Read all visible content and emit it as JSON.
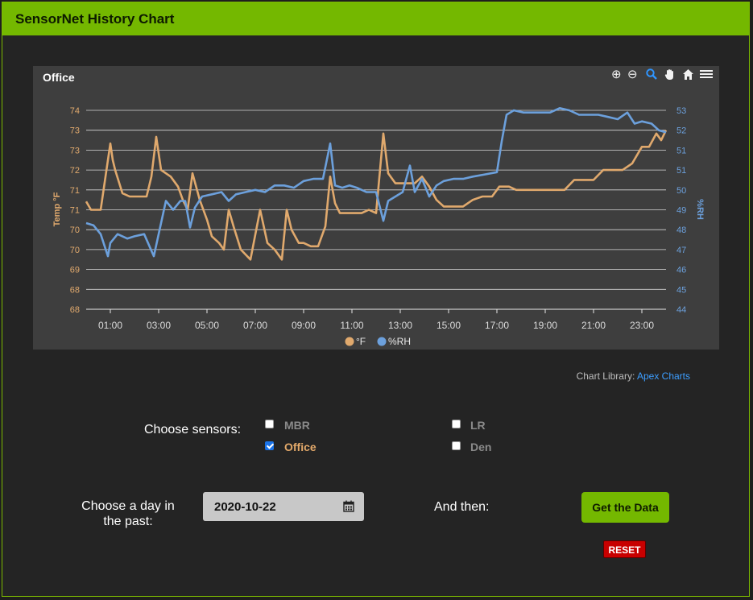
{
  "header": {
    "title": "SensorNet History Chart"
  },
  "chart_toolbar": {
    "icons": [
      "zoom-in-icon",
      "zoom-out-icon",
      "zoom-select-icon",
      "pan-hand-icon",
      "home-reset-icon",
      "menu-icon"
    ]
  },
  "chart_data": {
    "type": "line",
    "title": "Office",
    "x_unit": "hour of day",
    "x_ticks": [
      "01:00",
      "03:00",
      "05:00",
      "07:00",
      "09:00",
      "11:00",
      "13:00",
      "15:00",
      "17:00",
      "19:00",
      "21:00",
      "23:00"
    ],
    "xlim": [
      0,
      24
    ],
    "y_left": {
      "label": "Temp °F",
      "ylim": [
        68,
        74
      ],
      "ticks": [
        "74",
        "73",
        "73",
        "72",
        "71",
        "71",
        "70",
        "70",
        "69",
        "68",
        "68"
      ]
    },
    "y_right": {
      "label": "%RH",
      "ylim": [
        44,
        53
      ],
      "ticks": [
        "53",
        "52",
        "51",
        "51",
        "50",
        "49",
        "48",
        "47",
        "46",
        "45",
        "44"
      ]
    },
    "grid": true,
    "legend_position": "bottom-center",
    "series": [
      {
        "name": "°F",
        "axis": "left",
        "color": "#e0a96d",
        "points": [
          [
            0,
            71.25
          ],
          [
            0.2,
            71
          ],
          [
            0.6,
            71
          ],
          [
            0.8,
            72
          ],
          [
            1.0,
            73.0
          ],
          [
            1.1,
            72.5
          ],
          [
            1.2,
            72.2
          ],
          [
            1.5,
            71.5
          ],
          [
            1.8,
            71.4
          ],
          [
            2.2,
            71.4
          ],
          [
            2.5,
            71.4
          ],
          [
            2.7,
            72.0
          ],
          [
            2.9,
            73.2
          ],
          [
            3.1,
            72.2
          ],
          [
            3.5,
            72.0
          ],
          [
            3.8,
            71.7
          ],
          [
            4.0,
            71.3
          ],
          [
            4.2,
            71.0
          ],
          [
            4.4,
            72.1
          ],
          [
            4.7,
            71.3
          ],
          [
            5.0,
            70.7
          ],
          [
            5.2,
            70.2
          ],
          [
            5.5,
            70.0
          ],
          [
            5.7,
            69.8
          ],
          [
            5.9,
            71.0
          ],
          [
            6.1,
            70.5
          ],
          [
            6.4,
            69.8
          ],
          [
            6.8,
            69.5
          ],
          [
            7.2,
            71.0
          ],
          [
            7.5,
            70.0
          ],
          [
            7.8,
            69.8
          ],
          [
            8.1,
            69.5
          ],
          [
            8.3,
            71.0
          ],
          [
            8.5,
            70.4
          ],
          [
            8.8,
            70.0
          ],
          [
            9.0,
            70.0
          ],
          [
            9.3,
            69.9
          ],
          [
            9.6,
            69.9
          ],
          [
            9.9,
            70.5
          ],
          [
            10.1,
            72.0
          ],
          [
            10.3,
            71.2
          ],
          [
            10.5,
            70.9
          ],
          [
            10.8,
            70.9
          ],
          [
            11.1,
            70.9
          ],
          [
            11.4,
            70.9
          ],
          [
            11.7,
            71.0
          ],
          [
            12.0,
            70.9
          ],
          [
            12.3,
            73.3
          ],
          [
            12.5,
            72.1
          ],
          [
            12.8,
            71.8
          ],
          [
            13.2,
            71.8
          ],
          [
            13.6,
            71.8
          ],
          [
            13.9,
            72.0
          ],
          [
            14.2,
            71.7
          ],
          [
            14.5,
            71.3
          ],
          [
            14.8,
            71.1
          ],
          [
            15.2,
            71.1
          ],
          [
            15.6,
            71.1
          ],
          [
            16.0,
            71.3
          ],
          [
            16.4,
            71.4
          ],
          [
            16.8,
            71.4
          ],
          [
            17.1,
            71.7
          ],
          [
            17.5,
            71.7
          ],
          [
            17.8,
            71.6
          ],
          [
            18.2,
            71.6
          ],
          [
            18.6,
            71.6
          ],
          [
            19.0,
            71.6
          ],
          [
            19.4,
            71.6
          ],
          [
            19.8,
            71.6
          ],
          [
            20.2,
            71.9
          ],
          [
            20.6,
            71.9
          ],
          [
            21.0,
            71.9
          ],
          [
            21.4,
            72.2
          ],
          [
            21.8,
            72.2
          ],
          [
            22.2,
            72.2
          ],
          [
            22.6,
            72.4
          ],
          [
            23.0,
            72.9
          ],
          [
            23.3,
            72.9
          ],
          [
            23.6,
            73.3
          ],
          [
            23.8,
            73.1
          ],
          [
            24.0,
            73.4
          ]
        ]
      },
      {
        "name": "%RH",
        "axis": "right",
        "color": "#6ca0dc",
        "points": [
          [
            0,
            47.9
          ],
          [
            0.3,
            47.8
          ],
          [
            0.6,
            47.4
          ],
          [
            0.9,
            46.4
          ],
          [
            1.0,
            47.0
          ],
          [
            1.3,
            47.4
          ],
          [
            1.7,
            47.2
          ],
          [
            2.0,
            47.3
          ],
          [
            2.4,
            47.4
          ],
          [
            2.8,
            46.4
          ],
          [
            3.0,
            47.4
          ],
          [
            3.3,
            48.9
          ],
          [
            3.6,
            48.5
          ],
          [
            3.9,
            48.9
          ],
          [
            4.1,
            48.9
          ],
          [
            4.3,
            47.7
          ],
          [
            4.5,
            48.6
          ],
          [
            4.8,
            49.1
          ],
          [
            5.2,
            49.2
          ],
          [
            5.6,
            49.3
          ],
          [
            5.9,
            48.9
          ],
          [
            6.2,
            49.2
          ],
          [
            6.6,
            49.3
          ],
          [
            7.0,
            49.4
          ],
          [
            7.4,
            49.3
          ],
          [
            7.8,
            49.6
          ],
          [
            8.2,
            49.6
          ],
          [
            8.6,
            49.5
          ],
          [
            9.0,
            49.8
          ],
          [
            9.4,
            49.9
          ],
          [
            9.8,
            49.9
          ],
          [
            10.1,
            51.5
          ],
          [
            10.3,
            49.6
          ],
          [
            10.6,
            49.5
          ],
          [
            10.9,
            49.6
          ],
          [
            11.2,
            49.5
          ],
          [
            11.6,
            49.3
          ],
          [
            12.0,
            49.3
          ],
          [
            12.3,
            48.0
          ],
          [
            12.5,
            48.9
          ],
          [
            12.8,
            49.1
          ],
          [
            13.1,
            49.3
          ],
          [
            13.4,
            50.5
          ],
          [
            13.6,
            49.3
          ],
          [
            13.9,
            49.9
          ],
          [
            14.2,
            49.1
          ],
          [
            14.5,
            49.6
          ],
          [
            14.8,
            49.8
          ],
          [
            15.2,
            49.9
          ],
          [
            15.6,
            49.9
          ],
          [
            16.0,
            50.0
          ],
          [
            16.5,
            50.1
          ],
          [
            17.0,
            50.2
          ],
          [
            17.2,
            51.6
          ],
          [
            17.4,
            52.8
          ],
          [
            17.7,
            53.0
          ],
          [
            18.1,
            52.9
          ],
          [
            18.5,
            52.9
          ],
          [
            18.9,
            52.9
          ],
          [
            19.2,
            52.9
          ],
          [
            19.6,
            53.1
          ],
          [
            20.0,
            53.0
          ],
          [
            20.4,
            52.8
          ],
          [
            20.8,
            52.8
          ],
          [
            21.2,
            52.8
          ],
          [
            21.6,
            52.7
          ],
          [
            22.0,
            52.6
          ],
          [
            22.4,
            52.9
          ],
          [
            22.7,
            52.4
          ],
          [
            23.0,
            52.5
          ],
          [
            23.4,
            52.4
          ],
          [
            23.7,
            52.1
          ],
          [
            24.0,
            52.0
          ]
        ]
      }
    ]
  },
  "credit": {
    "prefix": "Chart Library:",
    "link": "Apex Charts"
  },
  "controls": {
    "choose_sensors_label": "Choose sensors:",
    "sensors": [
      {
        "name": "MBR",
        "checked": false
      },
      {
        "name": "Office",
        "checked": true
      },
      {
        "name": "LR",
        "checked": false
      },
      {
        "name": "Den",
        "checked": false
      }
    ],
    "choose_day_label_line1": "Choose a day in",
    "choose_day_label_line2": "the past:",
    "date_value": "2020-10-22",
    "and_then_label": "And then:",
    "get_data_button": "Get the Data",
    "reset_button": "RESET"
  }
}
